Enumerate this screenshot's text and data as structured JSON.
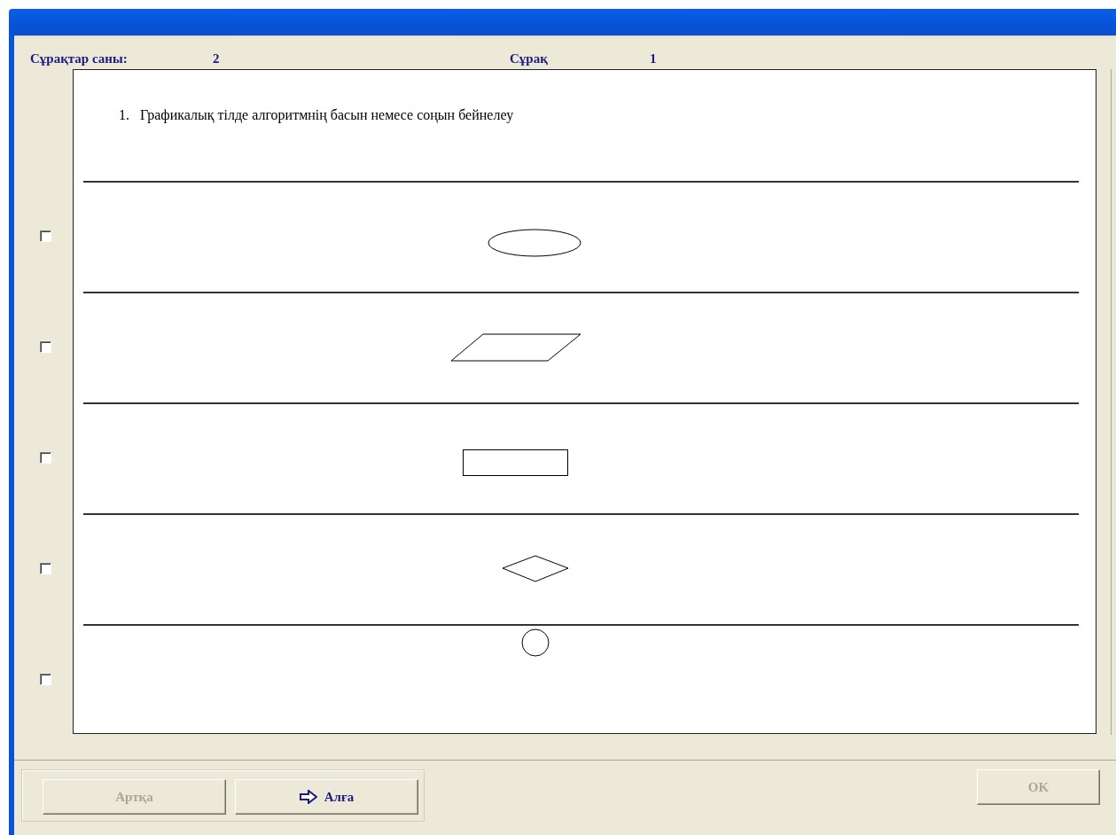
{
  "header": {
    "count_label": "Сұрақтар саны:",
    "count_value": "2",
    "question_label": "Сұрақ",
    "question_value": "1"
  },
  "question": {
    "number": "1.",
    "text": "Графикалық тілде алгоритмнің басын немесе соңын бейнелеу"
  },
  "options": [
    {
      "kind": "ellipse",
      "checked": false
    },
    {
      "kind": "parallelogram",
      "checked": false
    },
    {
      "kind": "rectangle",
      "checked": false
    },
    {
      "kind": "diamond",
      "checked": false
    },
    {
      "kind": "circle",
      "checked": false
    }
  ],
  "buttons": {
    "back": {
      "label": "Артқа",
      "disabled": true
    },
    "next": {
      "label": "Алға",
      "disabled": false
    },
    "ok": {
      "label": "OK",
      "disabled": true
    }
  }
}
